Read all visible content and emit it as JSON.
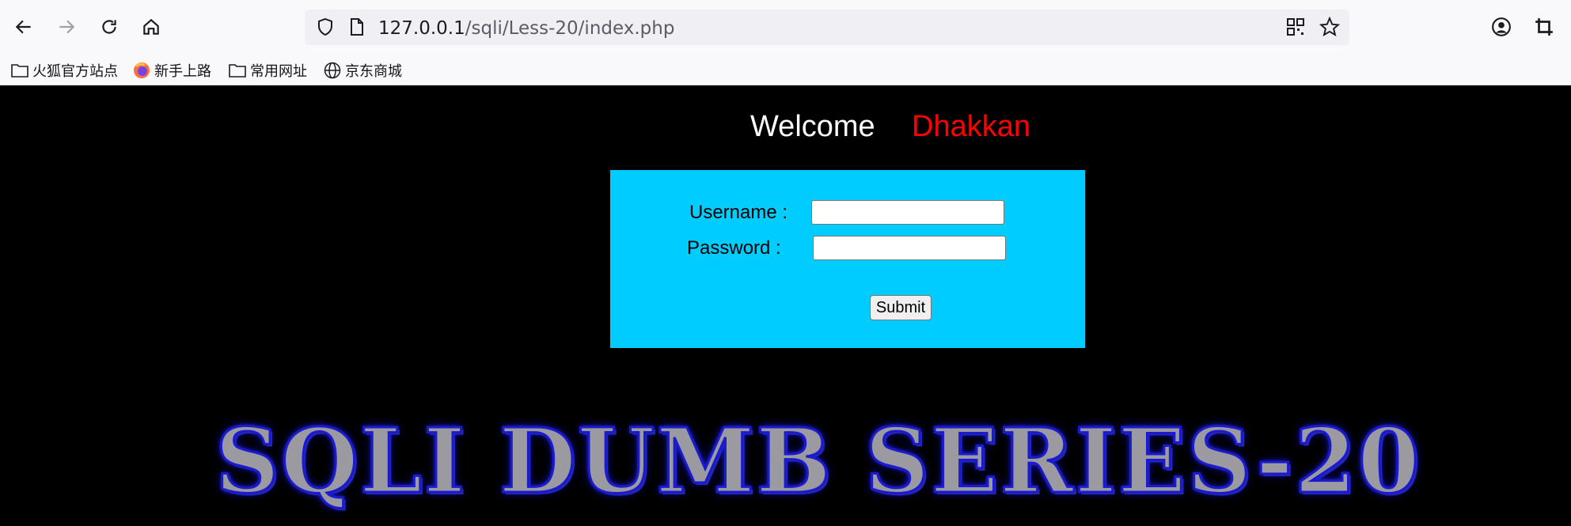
{
  "browser": {
    "url_host": "127.0.0.1",
    "url_path": "/sqli/Less-20/index.php",
    "nav_icons": [
      "back-icon",
      "forward-icon",
      "reload-icon",
      "home-icon"
    ],
    "bookmarks": [
      {
        "label": "火狐官方站点",
        "icon": "folder-icon"
      },
      {
        "label": "新手上路",
        "icon": "firefox-icon"
      },
      {
        "label": "常用网址",
        "icon": "folder-icon"
      },
      {
        "label": "京东商城",
        "icon": "globe-icon"
      }
    ]
  },
  "page": {
    "welcome": "Welcome",
    "name": "Dhakkan",
    "username_label": "Username :",
    "password_label": "Password :",
    "username_value": "",
    "password_value": "",
    "submit_label": "Submit",
    "banner": "SQLI DUMB SERIES-20",
    "colors": {
      "background": "#000000",
      "login_box": "#00ccff",
      "name": "#ff0000",
      "welcome": "#ffffff"
    }
  }
}
